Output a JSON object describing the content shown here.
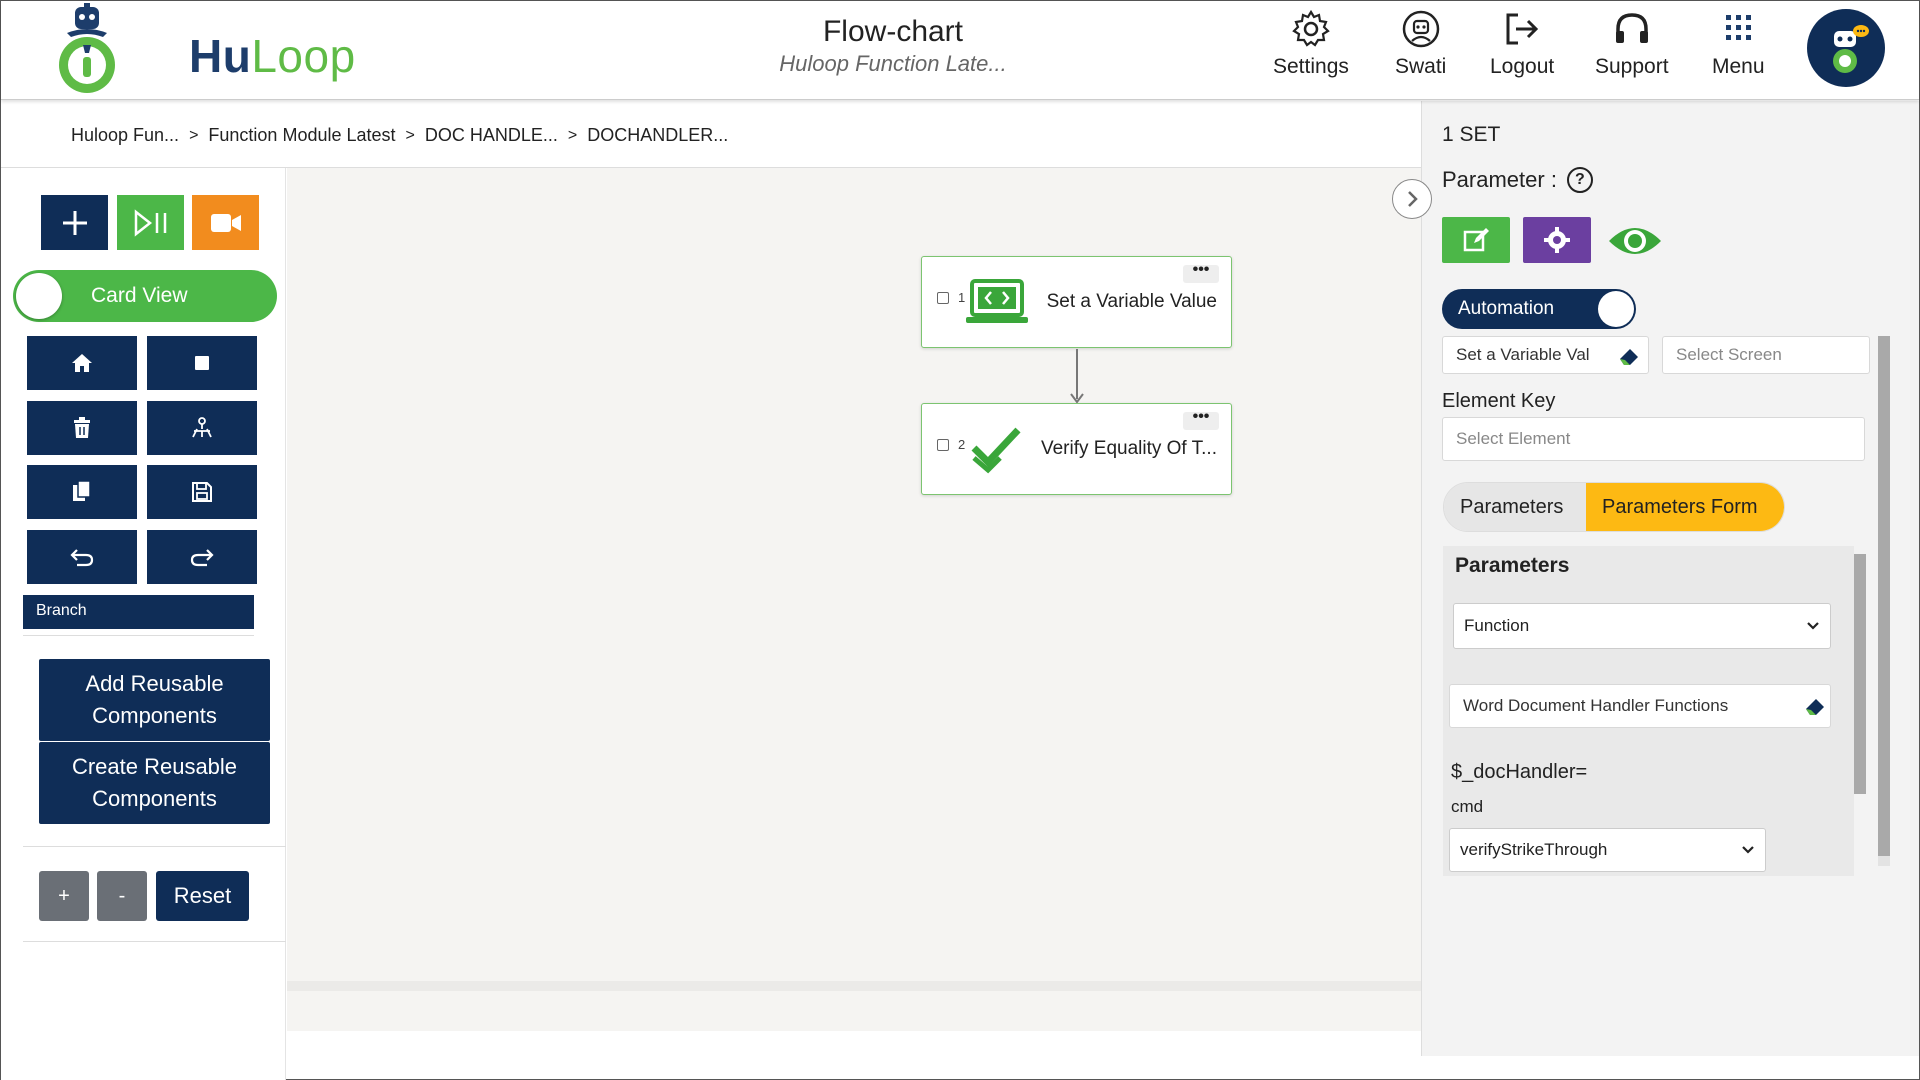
{
  "header": {
    "logo_hu": "Hu",
    "logo_loop": "Loop",
    "title": "Flow-chart",
    "subtitle": "Huloop Function Late...",
    "nav": [
      {
        "label": "Settings",
        "icon": "gear-icon"
      },
      {
        "label": "Swati",
        "icon": "user-circle-icon"
      },
      {
        "label": "Logout",
        "icon": "logout-icon"
      },
      {
        "label": "Support",
        "icon": "headset-icon"
      },
      {
        "label": "Menu",
        "icon": "grid-menu-icon"
      }
    ]
  },
  "breadcrumb": [
    "Huloop Fun...",
    "Function Module Latest",
    "DOC HANDLE...",
    "DOCHANDLER..."
  ],
  "toolbar": {
    "card_view_label": "Card View",
    "branch_label": "Branch",
    "add_reusable": "Add Reusable Components",
    "create_reusable": "Create Reusable Components",
    "zoom_in": "+",
    "zoom_out": "-",
    "reset": "Reset"
  },
  "flow": {
    "nodes": [
      {
        "num": "1",
        "label": "Set a Variable Value",
        "icon": "code-monitor-icon"
      },
      {
        "num": "2",
        "label": "Verify Equality Of T...",
        "icon": "double-check-icon"
      }
    ]
  },
  "panel": {
    "set_title": "1 SET",
    "parameter_label": "Parameter :",
    "help": "?",
    "automation_label": "Automation",
    "action_value": "Set a Variable Val",
    "screen_placeholder": "Select Screen",
    "element_key_label": "Element Key",
    "element_placeholder": "Select Element",
    "tab_parameters": "Parameters",
    "tab_parameters_form": "Parameters Form",
    "params_header": "Parameters",
    "function_select": "Function",
    "function_value": "Word Document Handler Functions",
    "doc_handler_label": "$_docHandler=",
    "cmd_label": "cmd",
    "cmd_value": "verifyStrikeThrough"
  },
  "colors": {
    "navy": "#0f2d57",
    "green": "#4cb748",
    "orange": "#f28c1e",
    "purple": "#6b3fa0",
    "yellow": "#fdb913"
  }
}
